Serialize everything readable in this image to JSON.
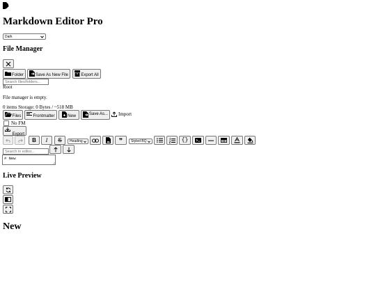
{
  "app": {
    "title": "Markdown Editor Pro"
  },
  "theme": {
    "selected": "Dark"
  },
  "file_manager": {
    "heading": "File Manager",
    "close_icon": "close-icon",
    "folder_label": "Folder",
    "save_as_new_file_label": "Save As New File",
    "export_all_label": "Export All",
    "search_placeholder": "Search files/folders...",
    "root_label": "Root",
    "empty_message": "File manager is empty.",
    "status": "0 items Storage: 0 Bytes / ~518 MB"
  },
  "toolbar": {
    "files_label": "Files",
    "frontmatter_label": "Frontmatter",
    "new_label": "New",
    "save_as_label": "Save As...",
    "import_label": "Import",
    "no_fm_label": "No FM",
    "export_label": "Export",
    "heading_select": "Heading",
    "blockquote_select": "Styled BQ"
  },
  "editor": {
    "search_placeholder": "Search in editor...",
    "content": "# New"
  },
  "preview": {
    "heading": "Live Preview",
    "rendered_title": "New"
  },
  "colors": {
    "button_bg": "#efefef",
    "button_border": "#767676",
    "text": "#000000"
  }
}
